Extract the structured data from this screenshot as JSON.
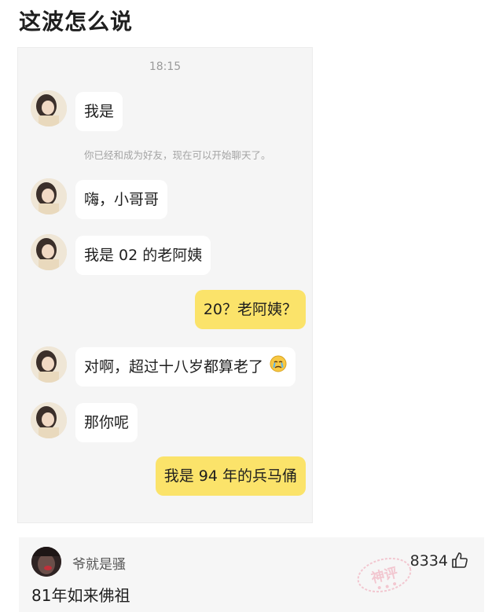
{
  "post": {
    "title": "这波怎么说"
  },
  "chat": {
    "time": "18:15",
    "system_notice": "你已经和成为好友，现在可以开始聊天了。",
    "messages": [
      {
        "side": "in",
        "text": "我是"
      },
      {
        "side": "in",
        "text": "嗨，小哥哥"
      },
      {
        "side": "in",
        "text": "我是 02 的老阿姨"
      },
      {
        "side": "out",
        "text": "20？老阿姨？"
      },
      {
        "side": "in",
        "text": "对啊，超过十八岁都算老了",
        "emoji": "crying-face"
      },
      {
        "side": "in",
        "text": "那你呢"
      },
      {
        "side": "out",
        "text": "我是 94 年的兵马俑"
      }
    ]
  },
  "comment": {
    "username": "爷就是骚",
    "likes": "8334",
    "text": "81年如来佛祖",
    "stamp_text": "神评",
    "like_icon": "thumbs-up-icon"
  },
  "colors": {
    "chat_background": "#f5f5f5",
    "incoming_bubble": "#ffffff",
    "outgoing_bubble": "#fbe36a",
    "comment_background": "#f6f6f6",
    "stamp": "#f0a8b8"
  }
}
